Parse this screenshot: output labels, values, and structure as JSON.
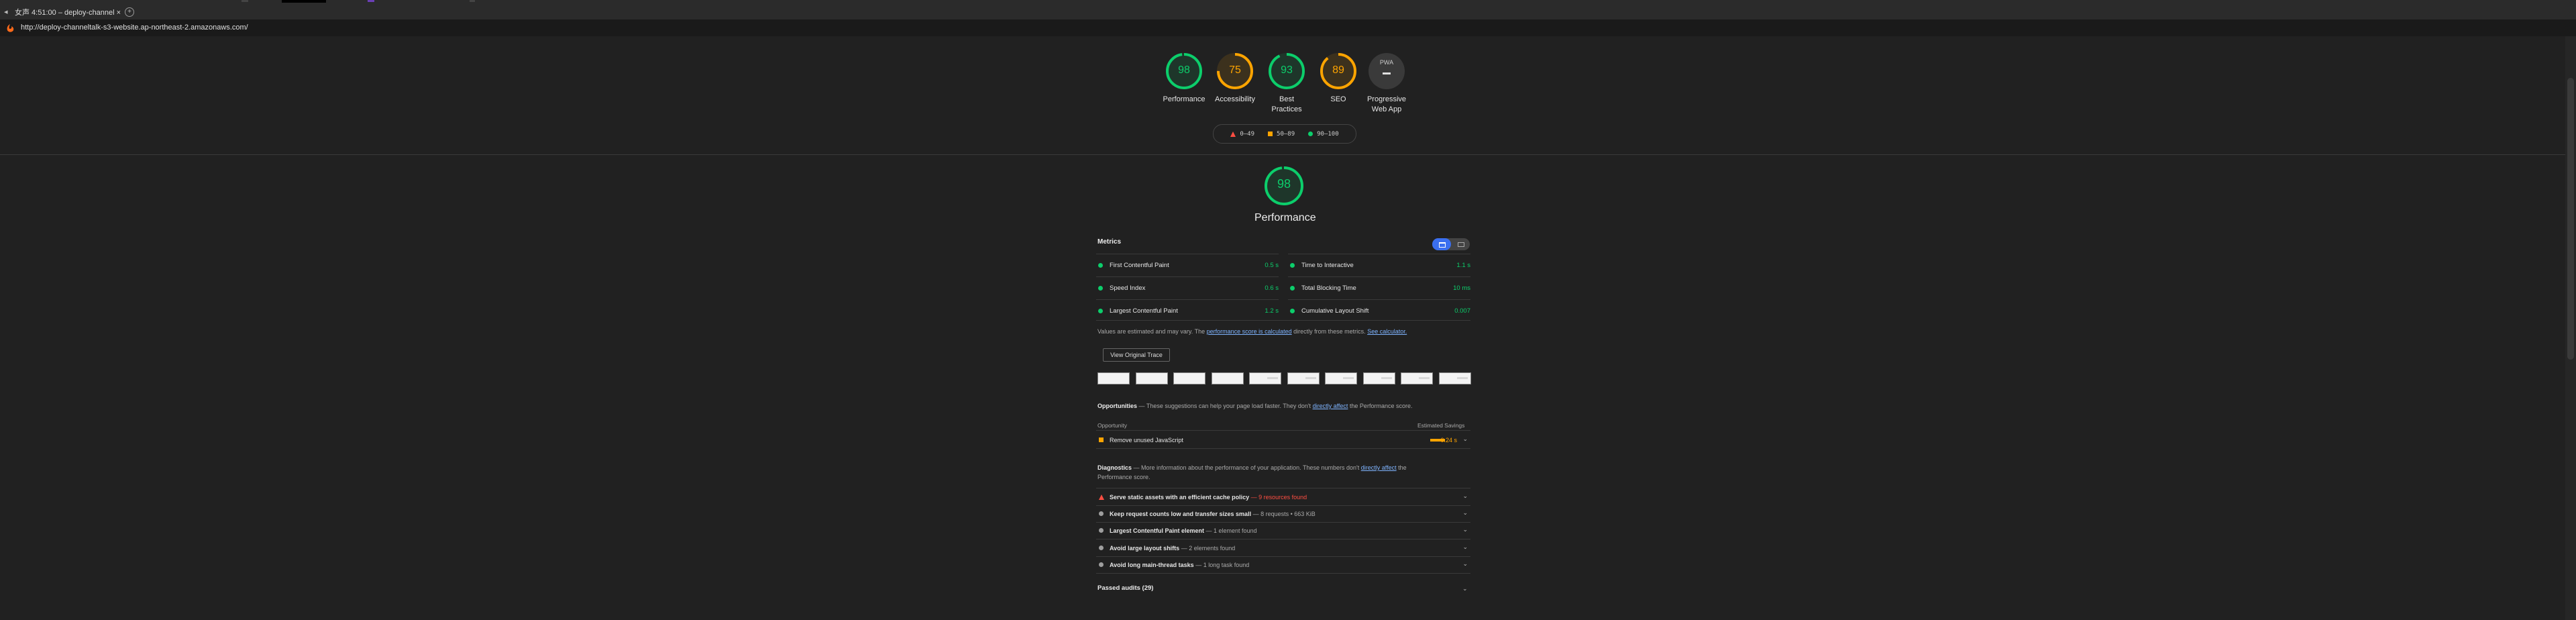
{
  "browser": {
    "tab_title": "女声 4:51:00 – deploy-channel ×",
    "url": "http://deploy-channeltalk-s3-website.ap-northeast-2.amazonaws.com/"
  },
  "summary_gauges": [
    {
      "score": "98",
      "label": "Performance",
      "color": "#0cce6b",
      "fraction": 0.98
    },
    {
      "score": "75",
      "label": "Accessibility",
      "color": "#ffa400",
      "fraction": 0.75
    },
    {
      "score": "93",
      "label": "Best Practices",
      "color": "#0cce6b",
      "fraction": 0.93
    },
    {
      "score": "89",
      "label": "SEO",
      "color": "#ffa400",
      "fraction": 0.89
    }
  ],
  "pwa": {
    "badge": "PWA",
    "label": "Progressive Web App"
  },
  "legend": {
    "fail": "0–49",
    "average": "50–89",
    "pass": "90–100"
  },
  "performance": {
    "score": "98",
    "title": "Performance",
    "fraction": 0.98,
    "color": "#0cce6b"
  },
  "metrics": {
    "title": "Metrics",
    "items": [
      {
        "name": "First Contentful Paint",
        "value": "0.5 s"
      },
      {
        "name": "Time to Interactive",
        "value": "1.1 s"
      },
      {
        "name": "Speed Index",
        "value": "0.6 s"
      },
      {
        "name": "Total Blocking Time",
        "value": "10 ms"
      },
      {
        "name": "Largest Contentful Paint",
        "value": "1.2 s"
      },
      {
        "name": "Cumulative Layout Shift",
        "value": "0.007"
      }
    ],
    "note_prefix": "Values are estimated and may vary. The ",
    "note_link1": "performance score is calculated",
    "note_mid": " directly from these metrics. ",
    "note_link2": "See calculator."
  },
  "trace_button": "View Original Trace",
  "opportunities": {
    "title": "Opportunities",
    "desc_prefix": " — These suggestions can help your page load faster. They don't ",
    "desc_link": "directly affect",
    "desc_suffix": " the Performance score.",
    "col_opportunity": "Opportunity",
    "col_savings": "Estimated Savings",
    "items": [
      {
        "title": "Remove unused JavaScript",
        "savings": "0.24 s"
      }
    ]
  },
  "diagnostics": {
    "title": "Diagnostics",
    "desc_prefix": " — More information about the performance of your application. These numbers don't ",
    "desc_link": "directly affect",
    "desc_suffix1": " the",
    "desc_suffix2": "Performance score.",
    "items": [
      {
        "title": "Serve static assets with an efficient cache policy",
        "detail": " — 9 resources found",
        "status": "fail"
      },
      {
        "title": "Keep request counts low and transfer sizes small",
        "detail": " — 8 requests • 663 KiB",
        "status": "info"
      },
      {
        "title": "Largest Contentful Paint element",
        "detail": " — 1 element found",
        "status": "info"
      },
      {
        "title": "Avoid large layout shifts",
        "detail": " — 2 elements found",
        "status": "info"
      },
      {
        "title": "Avoid long main-thread tasks",
        "detail": " — 1 long task found",
        "status": "info"
      }
    ]
  },
  "passed_audits": "Passed audits (29)"
}
